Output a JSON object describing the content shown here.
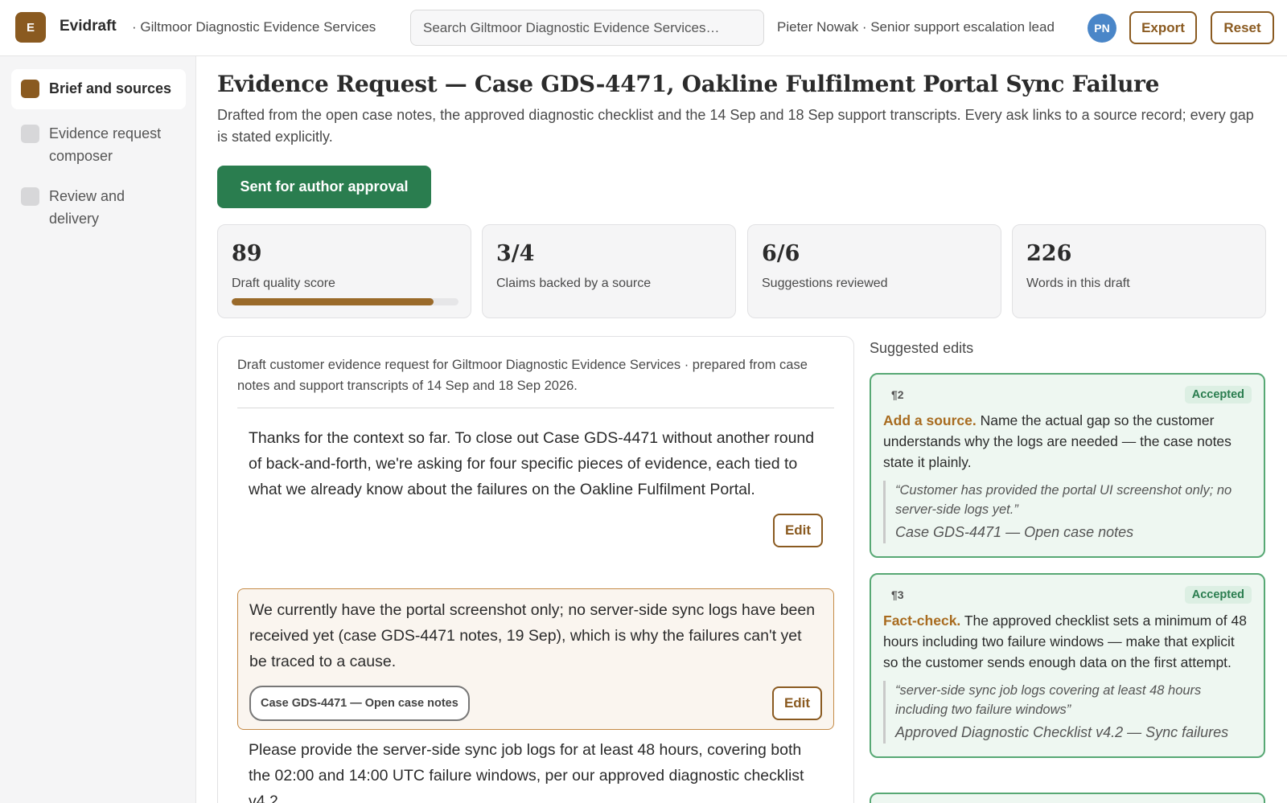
{
  "header": {
    "logo_letter": "E",
    "app_name": "Evidraft",
    "org": "· Giltmoor Diagnostic Evidence Services",
    "search_placeholder": "Search Giltmoor Diagnostic Evidence Services…",
    "user": "Pieter Nowak · Senior support escalation lead",
    "avatar_initials": "PN",
    "export_label": "Export",
    "reset_label": "Reset"
  },
  "sidebar": {
    "items": [
      {
        "label": "Brief and sources",
        "active": true
      },
      {
        "label": "Evidence request composer",
        "active": false
      },
      {
        "label": "Review and delivery",
        "active": false
      }
    ]
  },
  "main": {
    "title": "Evidence Request — Case GDS-4471, Oakline Fulfilment Portal Sync Failure",
    "subtitle": "Drafted from the open case notes, the approved diagnostic checklist and the 14 Sep and 18 Sep support transcripts. Every ask links to a source record; every gap is stated explicitly.",
    "approval_label": "Sent for author approval",
    "stats": [
      {
        "value": "89",
        "label": "Draft quality score",
        "progress": 0.89
      },
      {
        "value": "3/4",
        "label": "Claims backed by a source"
      },
      {
        "value": "6/6",
        "label": "Suggestions reviewed"
      },
      {
        "value": "226",
        "label": "Words in this draft"
      }
    ]
  },
  "draft": {
    "header": "Draft customer evidence request for Giltmoor Diagnostic Evidence Services · prepared from case notes and support transcripts of 14 Sep and 18 Sep 2026.",
    "edit_label": "Edit",
    "paragraphs": [
      {
        "text": "Thanks for the context so far. To close out Case GDS-4471 without another round of back-and-forth, we're asking for four specific pieces of evidence, each tied to what we already know about the failures on the Oakline Fulfilment Portal."
      },
      {
        "text": "We currently have the portal screenshot only; no server-side sync logs have been received yet (case GDS-4471 notes, 19 Sep), which is why the failures can't yet be traced to a cause.",
        "source": "Case GDS-4471 — Open case notes"
      },
      {
        "text": "Please provide the server-side sync job logs for at least 48 hours, covering both the 02:00 and 14:00 UTC failure windows, per our approved diagnostic checklist v4.2."
      }
    ]
  },
  "suggestions": {
    "title": "Suggested edits",
    "cards": [
      {
        "para": "¶2",
        "status": "Accepted",
        "kind": "Add a source.",
        "text": " Name the actual gap so the customer understands why the logs are needed — the case notes state it plainly.",
        "quote": "“Customer has provided the portal UI screenshot only; no server-side logs yet.”",
        "source": "Case GDS-4471 — Open case notes"
      },
      {
        "para": "¶3",
        "status": "Accepted",
        "kind": "Fact-check.",
        "text": " The approved checklist sets a minimum of 48 hours including two failure windows — make that explicit so the customer sends enough data on the first attempt.",
        "quote": "“server-side sync job logs covering at least 48 hours including two failure windows”",
        "source": "Approved Diagnostic Checklist v4.2 — Sync failures"
      }
    ]
  }
}
